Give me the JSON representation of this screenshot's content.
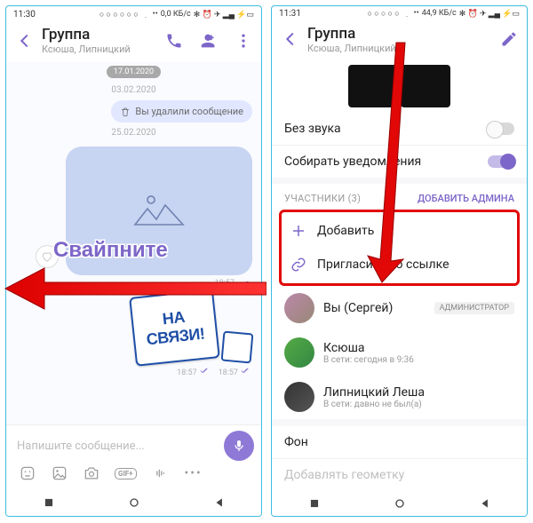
{
  "overlay": {
    "swipe_label": "Свайпните"
  },
  "left": {
    "status": {
      "time": "11:30",
      "net": "0,0 КБ/с"
    },
    "header": {
      "title": "Группа",
      "subtitle": "Ксюша, Липницкий"
    },
    "chat": {
      "datePill": "17.01.2020",
      "date1": "03.02.2020",
      "deleted_msg": "Вы удалили сообщение",
      "date2": "25.02.2020",
      "sticker_time1": "18:57",
      "na_svyazi_1": "НА",
      "na_svyazi_2": "СВЯЗИ!",
      "sticker_time2a": "18:57",
      "sticker_time2b": "18:57"
    },
    "compose": {
      "placeholder": "Напишите сообщение...",
      "gif": "GIF+"
    }
  },
  "right": {
    "status": {
      "time": "11:31",
      "net": "44,9 КБ/с"
    },
    "header": {
      "title": "Группа",
      "subtitle": "Ксюша, Липницкий"
    },
    "settings": {
      "mute": "Без звука",
      "smart": "Собирать уведомления"
    },
    "section": {
      "participants": "УЧАСТНИКИ (3)",
      "add_admin": "ДОБАВИТЬ АДМИНА",
      "add": "Добавить",
      "invite_link": "Пригласить по ссылке"
    },
    "members": {
      "m1_name": "Вы (Сергей)",
      "m1_badge": "АДМИНИСТРАТОР",
      "m2_name": "Ксюша",
      "m2_sub": "В сети: сегодня в 9:36",
      "m3_name": "Липницкий Леша",
      "m3_sub": "В сети: давно не был(а)"
    },
    "background_row": "Фон",
    "geo_row": "Добавлять геометку"
  }
}
